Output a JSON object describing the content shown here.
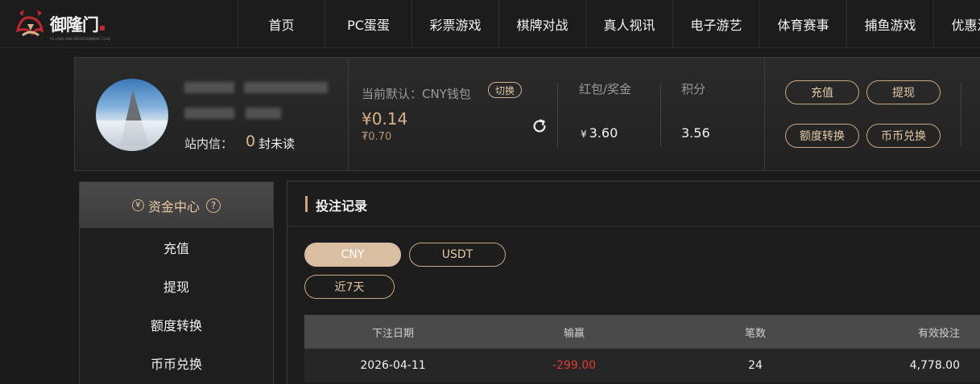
{
  "logo": {
    "text": "御隆门",
    "subtitle": "YU LONG MEN ENTERTAINMENT CLUB"
  },
  "nav": [
    {
      "label": "首页"
    },
    {
      "label": "PC蛋蛋"
    },
    {
      "label": "彩票游戏"
    },
    {
      "label": "棋牌对战"
    },
    {
      "label": "真人视讯"
    },
    {
      "label": "电子游艺"
    },
    {
      "label": "体育赛事"
    },
    {
      "label": "捕鱼游戏"
    },
    {
      "label": "优惠活动"
    }
  ],
  "profile": {
    "inbox_label": "站内信：",
    "inbox_count": "0",
    "inbox_suffix": "封未读",
    "wallet_label": "当前默认：CNY钱包",
    "switch_label": "切换",
    "balance": "¥0.14",
    "balance_sub": "₮0.70",
    "bonus_label": "红包/奖金",
    "bonus_currency": "¥",
    "bonus_value": "3.60",
    "points_label": "积分",
    "points_value": "3.56",
    "buttons": {
      "deposit": "充值",
      "withdraw": "提现",
      "transfer": "额度转换",
      "exchange": "币币兑换"
    }
  },
  "side": {
    "title": "资金中心",
    "title_icon": "yen-circle-icon",
    "help": "?",
    "items": [
      {
        "label": "充值"
      },
      {
        "label": "提现"
      },
      {
        "label": "额度转换"
      },
      {
        "label": "币币兑换"
      }
    ]
  },
  "main": {
    "title": "投注记录",
    "currency_tabs": [
      {
        "label": "CNY",
        "active": true
      },
      {
        "label": "USDT",
        "active": false
      }
    ],
    "range_label": "近7天",
    "columns": [
      "下注日期",
      "输赢",
      "笔数",
      "有效投注"
    ],
    "rows": [
      {
        "date": "2026-04-11",
        "win_loss": "-299.00",
        "count": "24",
        "valid_bet": "4,778.00"
      }
    ]
  },
  "colors": {
    "accent": "#c9a783",
    "negative": "#e53b32"
  }
}
